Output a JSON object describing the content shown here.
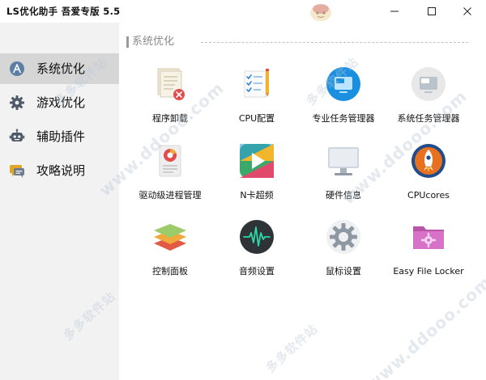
{
  "window": {
    "title": "LS优化助手 吾爱专版 5.5",
    "controls": [
      "minimize-icon",
      "maximize-icon",
      "close-icon"
    ]
  },
  "sidebar": {
    "items": [
      {
        "label": "系统优化",
        "icon": "system-optimize-icon",
        "active": true
      },
      {
        "label": "游戏优化",
        "icon": "gear-icon",
        "active": false
      },
      {
        "label": "辅助插件",
        "icon": "robot-icon",
        "active": false
      },
      {
        "label": "攻略说明",
        "icon": "chat-bubble-icon",
        "active": false
      }
    ]
  },
  "main": {
    "section_title": "系统优化",
    "tiles": [
      {
        "label": "程序卸载",
        "icon": "uninstall-icon"
      },
      {
        "label": "CPU配置",
        "icon": "cpu-config-icon"
      },
      {
        "label": "专业任务管理器",
        "icon": "pro-task-manager-icon"
      },
      {
        "label": "系统任务管理器",
        "icon": "system-task-manager-icon"
      },
      {
        "label": "驱动级进程管理",
        "icon": "driver-process-icon"
      },
      {
        "label": "N卡超频",
        "icon": "nvidia-overclock-icon"
      },
      {
        "label": "硬件信息",
        "icon": "monitor-icon"
      },
      {
        "label": "CPUcores",
        "icon": "rocket-icon"
      },
      {
        "label": "控制面板",
        "icon": "layers-icon"
      },
      {
        "label": "音频设置",
        "icon": "audio-wave-icon"
      },
      {
        "label": "鼠标设置",
        "icon": "gear-icon"
      },
      {
        "label": "Easy File Locker",
        "icon": "folder-lock-icon"
      }
    ]
  },
  "watermark": {
    "text_cn": "多多软件站",
    "text_url": "www.ddooo.com"
  },
  "colors": {
    "sidebar_bg": "#f2f2f2",
    "sidebar_active": "#d6d6d6",
    "section_title": "#8a8a8a",
    "uninstall_red": "#e24b4b",
    "task_blue": "#1a8fe0",
    "rocket_orange": "#e8711f",
    "folder_pink": "#d872c9"
  }
}
